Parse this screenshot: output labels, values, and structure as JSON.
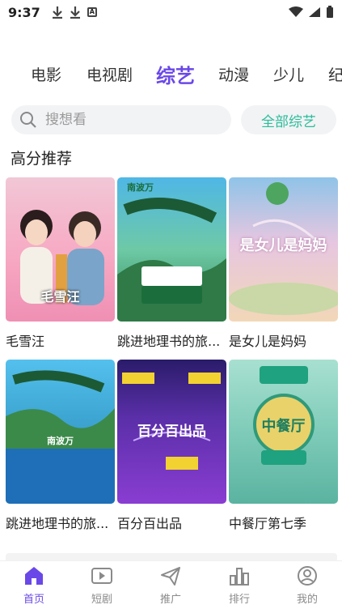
{
  "status_bar": {
    "time": "9:37",
    "icons": [
      "download-icon",
      "download-icon",
      "a-box-icon"
    ],
    "right_icons": [
      "wifi-icon",
      "signal-icon",
      "battery-icon"
    ],
    "a_box_label": "A"
  },
  "tabs": [
    {
      "label": "电影",
      "active": false
    },
    {
      "label": "电视剧",
      "active": false
    },
    {
      "label": "综艺",
      "active": true
    },
    {
      "label": "动漫",
      "active": false
    },
    {
      "label": "少儿",
      "active": false
    },
    {
      "label": "纪",
      "active": false
    }
  ],
  "search": {
    "placeholder": "搜想看",
    "all_button_label": "全部综艺"
  },
  "section": {
    "title": "高分推荐"
  },
  "shows": [
    {
      "title": "毛雪汪",
      "poster_text": "毛雪汪"
    },
    {
      "title": "跳进地理书的旅...",
      "poster_text": "南波万"
    },
    {
      "title": "是女儿是妈妈",
      "poster_text": "是女儿是妈妈"
    },
    {
      "title": "跳进地理书的旅...",
      "poster_text": "南波万"
    },
    {
      "title": "百分百出品",
      "poster_text": "百分百出品"
    },
    {
      "title": "中餐厅第七季",
      "poster_text": "中餐厅"
    }
  ],
  "bottom_nav": [
    {
      "label": "首页",
      "icon": "home-icon",
      "active": true
    },
    {
      "label": "短剧",
      "icon": "play-icon",
      "active": false
    },
    {
      "label": "推广",
      "icon": "send-icon",
      "active": false
    },
    {
      "label": "排行",
      "icon": "rank-icon",
      "active": false
    },
    {
      "label": "我的",
      "icon": "user-icon",
      "active": false
    }
  ],
  "colors": {
    "accent": "#6a48e8",
    "green_accent": "#2bbd9a"
  }
}
